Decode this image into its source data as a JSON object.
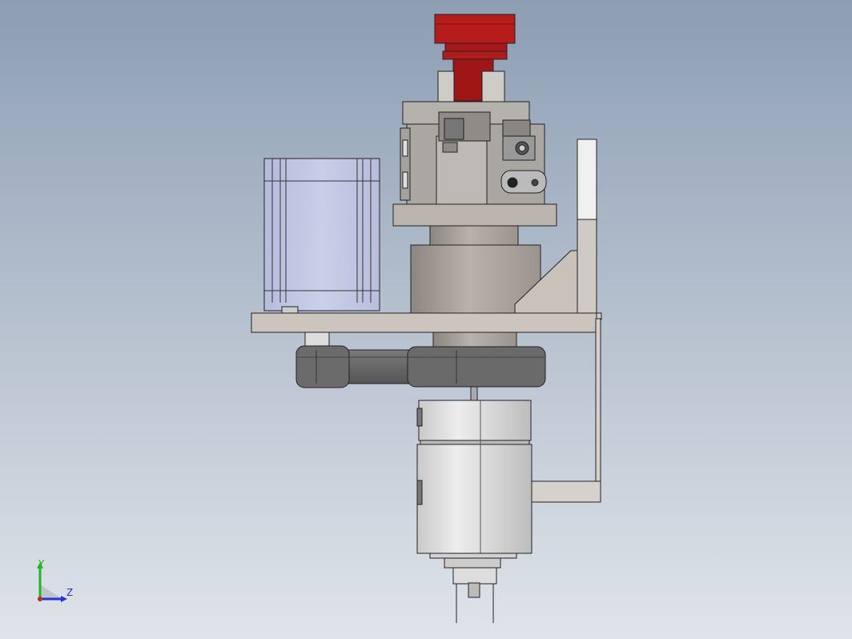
{
  "view": {
    "background_top": "#8c9db2",
    "background_bottom": "#dfe4ea"
  },
  "model": {
    "parts": [
      {
        "name": "red-cap",
        "color": "#b01c1c"
      },
      {
        "name": "stepper-motor",
        "color": "#c3c8e6"
      },
      {
        "name": "gripper-housing",
        "color": "#b9b6b2"
      },
      {
        "name": "mounting-plate",
        "color": "#c6c1bb"
      },
      {
        "name": "timing-belt",
        "color": "#666666"
      },
      {
        "name": "rotary-cylinder",
        "color": "#e2e2e2"
      },
      {
        "name": "side-bracket",
        "color": "#d9d9d9"
      }
    ]
  },
  "triad": {
    "y_label": "Y",
    "z_label": "Z",
    "y_color": "#1fb81f",
    "z_color": "#2233dd",
    "x_color": "#cc2222"
  }
}
